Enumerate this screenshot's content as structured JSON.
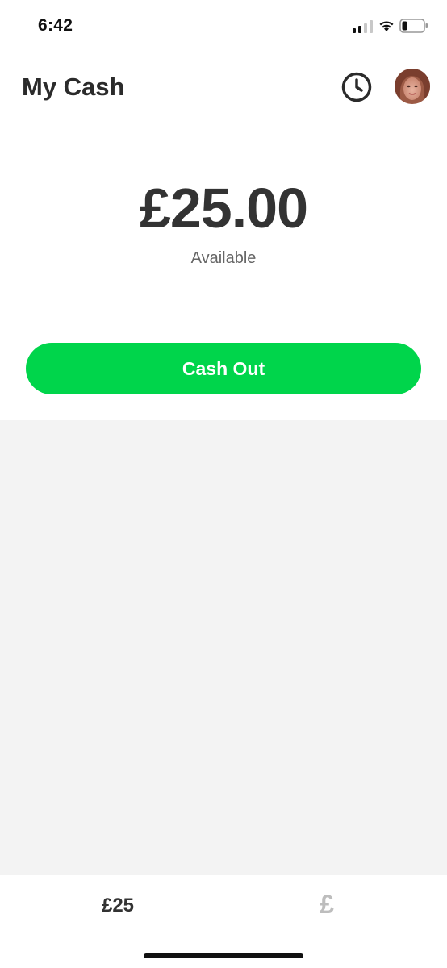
{
  "status_bar": {
    "time": "6:42",
    "signal_icon": "cellular-signal-icon",
    "wifi_icon": "wifi-icon",
    "battery_icon": "battery-low-icon",
    "battery_level": 0.2
  },
  "header": {
    "title": "My Cash",
    "history_icon": "clock-icon",
    "avatar_icon": "profile-avatar"
  },
  "balance": {
    "amount": "£25.00",
    "caption": "Available"
  },
  "actions": {
    "cash_out_label": "Cash Out"
  },
  "tab_bar": {
    "balance_tab_label": "£25",
    "currency_tab_label": "£"
  },
  "colors": {
    "accent_green": "#00d54b",
    "text_dark": "#333333",
    "text_muted": "#666666",
    "content_bg": "#f3f3f3",
    "inactive_tab": "#bdbdbd"
  }
}
